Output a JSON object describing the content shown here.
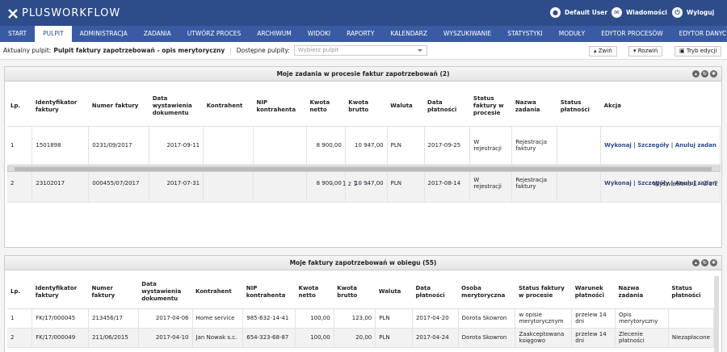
{
  "app": {
    "logo": "PLUSWORKFLOW",
    "user": "Default User",
    "messages": "Wiadomości",
    "logout": "Wyloguj"
  },
  "nav": [
    "START",
    "PULPIT",
    "ADMINISTRACJA",
    "ZADANIA",
    "UTWÓRZ PROCES",
    "ARCHIWUM",
    "WIDOKI",
    "RAPORTY",
    "KALENDARZ",
    "WYSZUKIWANIE",
    "STATYSTYKI",
    "MODUŁY",
    "EDYTOR PROCESÓW",
    "EDYTOR DANYCH"
  ],
  "pulpit": {
    "label": "Aktualny pulpit:",
    "name": "Pulpit faktury zapotrzebowań - opis merytoryczny",
    "available": "Dostępne pulpity:",
    "placeholder": "Wybierz pulpit",
    "collapse": "Zwiń",
    "expand": "Rozwiń",
    "edit": "Tryb edycji"
  },
  "panel1": {
    "title": "Moje zadania w procesie faktur zapotrzebowań (2)",
    "headers": [
      "Lp.",
      "Identyfikator faktury",
      "Numer faktury",
      "Data wystawienia dokumentu",
      "Kontrahent",
      "NIP kontrahenta",
      "Kwota netto",
      "Kwota brutto",
      "Waluta",
      "Data płatności",
      "Status faktury w procesie",
      "Nazwa zadania",
      "Status płatności",
      "Akcja"
    ],
    "rows": [
      [
        "1",
        "1501898",
        "0231/09/2017",
        "2017-09-11",
        "",
        "",
        "8 900,00",
        "10 947,00",
        "PLN",
        "2017-09-25",
        "W rejestracji",
        "Rejestracja faktury",
        "",
        "Wykonaj | Szczegóły | Anuluj zadan"
      ],
      [
        "2",
        "23102017",
        "000455/07/2017",
        "2017-07-31",
        "",
        "",
        "8 900,00",
        "10 947,00",
        "PLN",
        "2017-08-14",
        "W rejestracji",
        "Rejestracja faktury",
        "",
        "Wykonaj | Szczegóły | Anuluj zadan"
      ]
    ],
    "pager": "1 z 1",
    "shown": "Wyświetlono 1 - 2 z 2"
  },
  "panel2": {
    "title": "Moje faktury zapotrzebowań w obiegu (55)",
    "headers": [
      "Lp.",
      "Identyfikator faktury",
      "Numer faktury",
      "Data wystawienia dokumentu",
      "Kontrahent",
      "NIP kontrahenta",
      "Kwota netto",
      "Kwota brutto",
      "Waluta",
      "Data płatności",
      "Osoba merytoryczna",
      "Status faktury w procesie",
      "Warunek płatności",
      "Nazwa zadania",
      "Status płatności"
    ],
    "rows": [
      [
        "1",
        "FK/17/000045",
        "213456/17",
        "2017-04-06",
        "Home service",
        "985-632-14-41",
        "100,00",
        "123,00",
        "PLN",
        "2017-04-20",
        "Dorota Skowron",
        "w opisie merytorycznym",
        "przelew 14 dni",
        "Opis merytoryczny",
        ""
      ],
      [
        "2",
        "FK/17/000049",
        "211/06/2015",
        "2017-04-10",
        "Jan Nowak s.c.",
        "654-323-68-87",
        "100,00",
        "20,00",
        "PLN",
        "2017-04-24",
        "Dorota Skowron",
        "Zaakceptowana księgowo",
        "przelew 14 dni",
        "Zlecenie płatności",
        "Niezapłacone"
      ]
    ]
  }
}
